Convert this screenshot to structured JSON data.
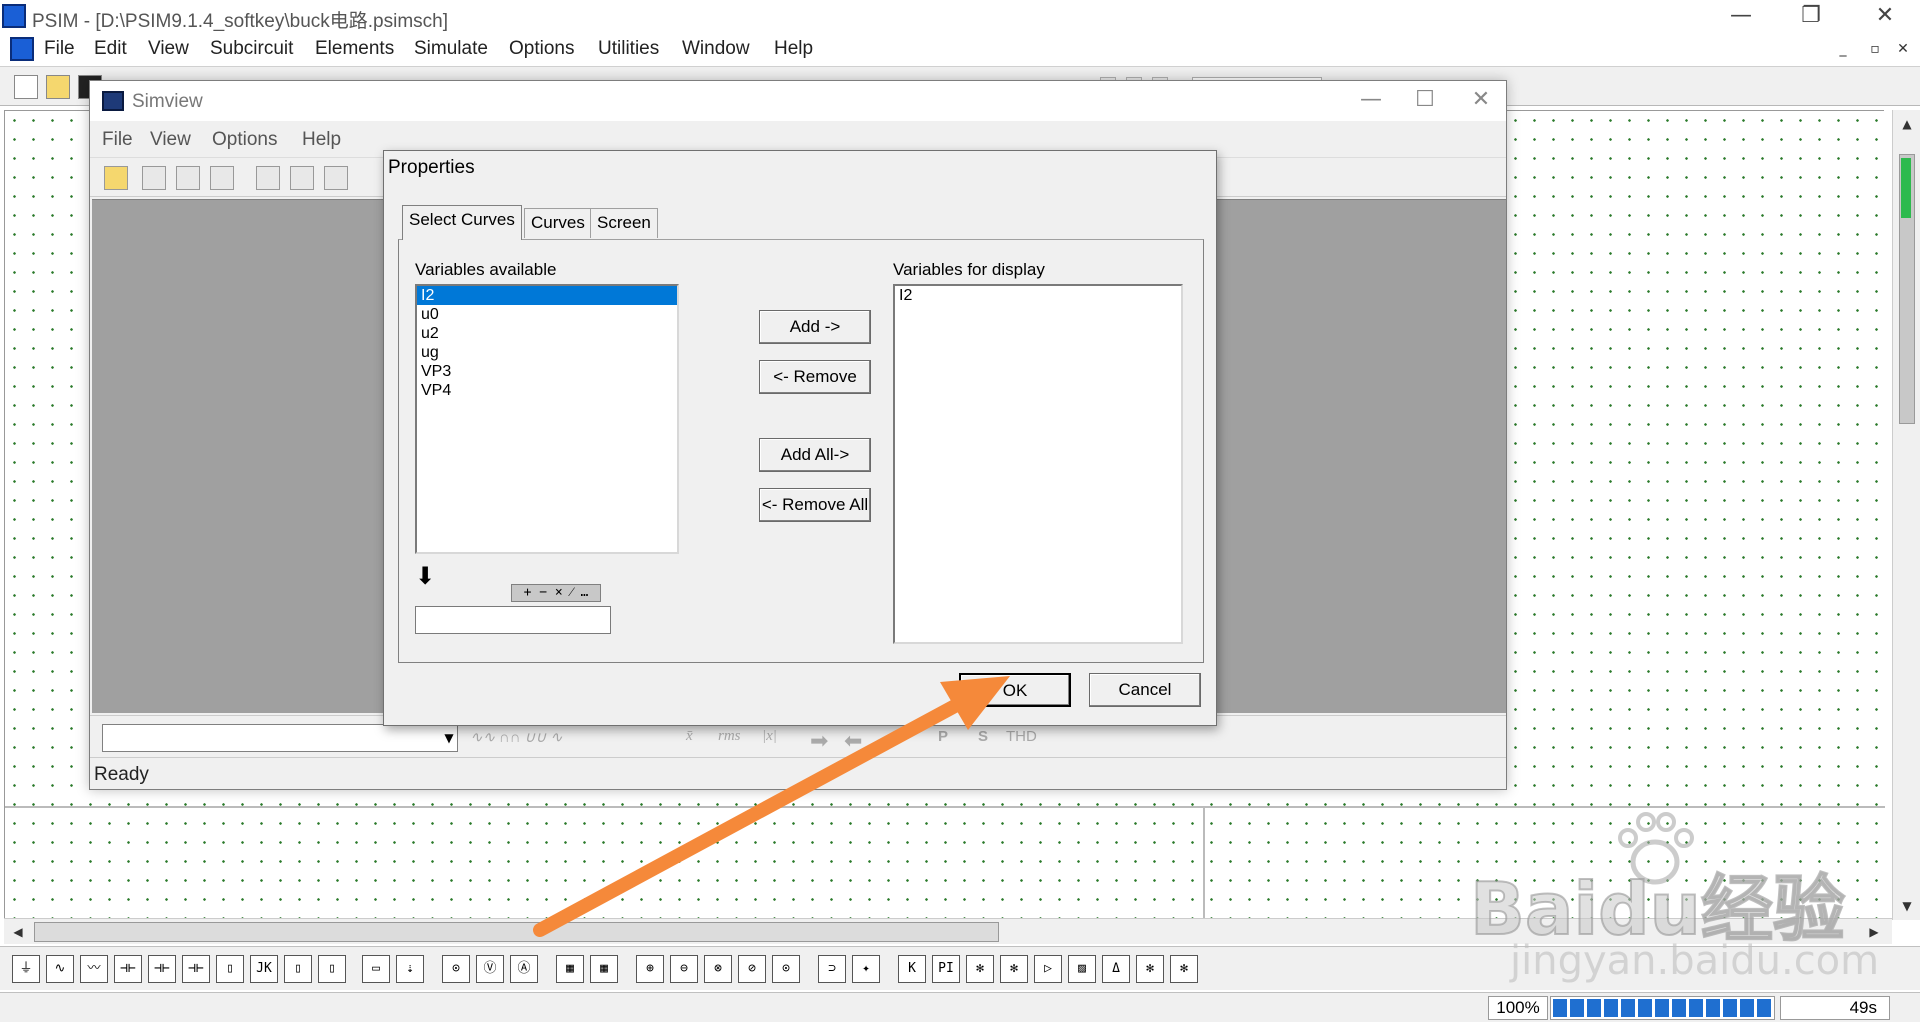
{
  "psim": {
    "title": "PSIM - [D:\\PSIM9.1.4_softkey\\buck电路.psimsch]",
    "menu": [
      "File",
      "Edit",
      "View",
      "Subcircuit",
      "Elements",
      "Simulate",
      "Options",
      "Utilities",
      "Window",
      "Help"
    ],
    "window_controls": {
      "minimize": "—",
      "restore": "❐",
      "close": "✕"
    },
    "mdi_controls": {
      "minimize": "_",
      "restore": "▫",
      "close": "✕"
    }
  },
  "element_toolbar": {
    "icons": [
      "⏚",
      "∿",
      "〰",
      "⊣⊢",
      "⊣⊢",
      "⊣⊢",
      "▯",
      "JK",
      "▯",
      "▯",
      "▭",
      "⇣",
      "⊙",
      "Ⓥ",
      "Ⓐ",
      "▦",
      "▦",
      "⊕",
      "⊖",
      "⊗",
      "⊘",
      "⊙",
      "⊃",
      "✦",
      "K",
      "PI",
      "✻",
      "✻",
      "▷",
      "▨",
      "Δ",
      "✻",
      "✻"
    ]
  },
  "status_bar": {
    "zoom": "100%",
    "progress": 1.0,
    "time": "49s"
  },
  "simview": {
    "title": "Simview",
    "menu": [
      "File",
      "View",
      "Options",
      "Help"
    ],
    "window_controls": {
      "minimize": "—",
      "maximize": "☐",
      "close": "✕"
    },
    "bottom_labels": {
      "avg": "x̄",
      "rms": "rms",
      "abs": "|x|",
      "p": "P",
      "s": "S",
      "thd": "THD"
    },
    "status": "Ready"
  },
  "properties": {
    "title": "Properties",
    "tabs": [
      "Select Curves",
      "Curves",
      "Screen"
    ],
    "variables_available_label": "Variables available",
    "variables_available": [
      "I2",
      "u0",
      "u2",
      "ug",
      "VP3",
      "VP4"
    ],
    "selected_variable": "I2",
    "variables_for_display_label": "Variables for display",
    "variables_for_display": [
      "I2"
    ],
    "buttons": {
      "add": "Add ->",
      "remove": "<- Remove",
      "add_all": "Add All->",
      "remove_all": "<- Remove All",
      "ok": "OK",
      "cancel": "Cancel"
    },
    "operators": "+ − × ⁄ …",
    "expression": ""
  },
  "annotation": {
    "color": "#f5893a"
  },
  "watermark": {
    "brand": "Baidu经验",
    "domain": "jingyan.baidu.com"
  }
}
